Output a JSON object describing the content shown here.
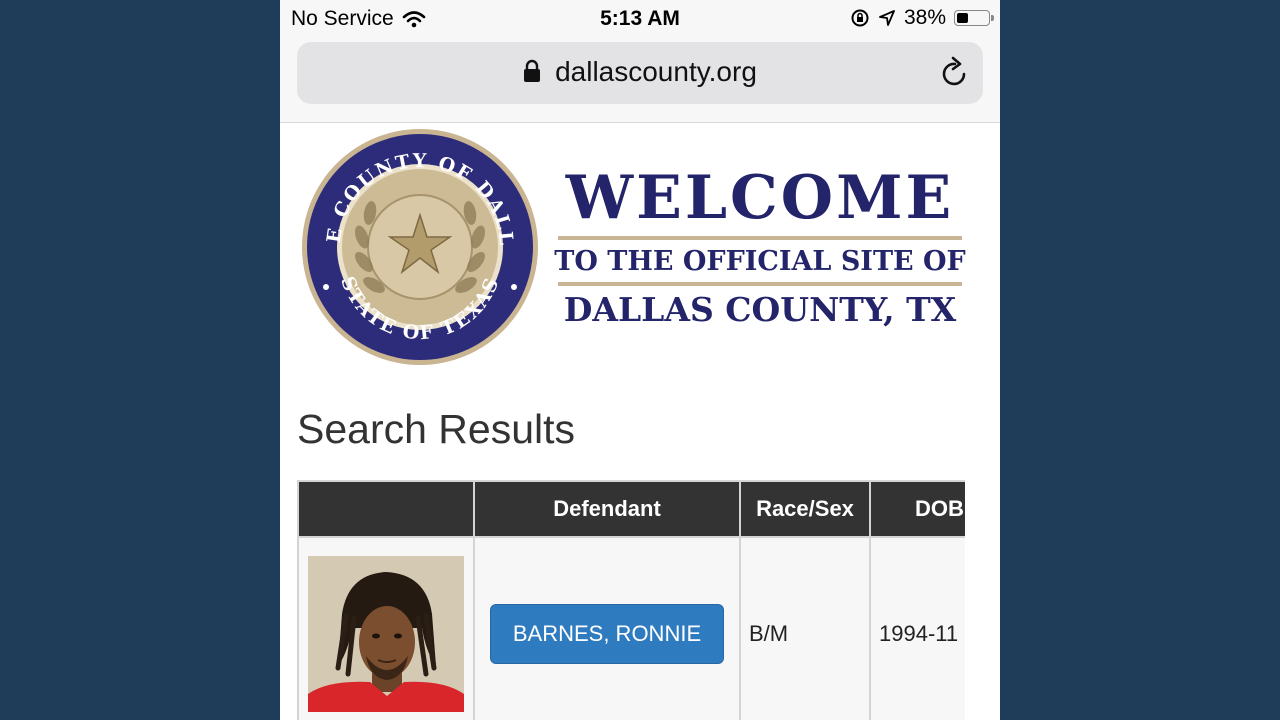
{
  "status_bar": {
    "carrier": "No Service",
    "time": "5:13 AM",
    "battery_text": "38%",
    "battery_level": 0.38
  },
  "browser": {
    "url": "dallascounty.org"
  },
  "header": {
    "seal_text_top": "THE COUNTY OF DALLAS",
    "seal_text_bottom": "STATE OF TEXAS",
    "welcome": "WELCOME",
    "subtitle": "TO THE OFFICIAL SITE OF",
    "county": "DALLAS COUNTY, TX"
  },
  "results": {
    "title": "Search Results",
    "columns": [
      "",
      "Defendant",
      "Race/Sex",
      "DOB"
    ],
    "rows": [
      {
        "defendant": "BARNES, RONNIE",
        "race_sex": "B/M",
        "dob": "1994-11"
      }
    ]
  },
  "colors": {
    "page_background": "#1f3d58",
    "seal_blue": "#2d2c7a",
    "welcome_navy": "#23246a",
    "button_blue": "#2f7bbf",
    "table_header": "#333333"
  }
}
